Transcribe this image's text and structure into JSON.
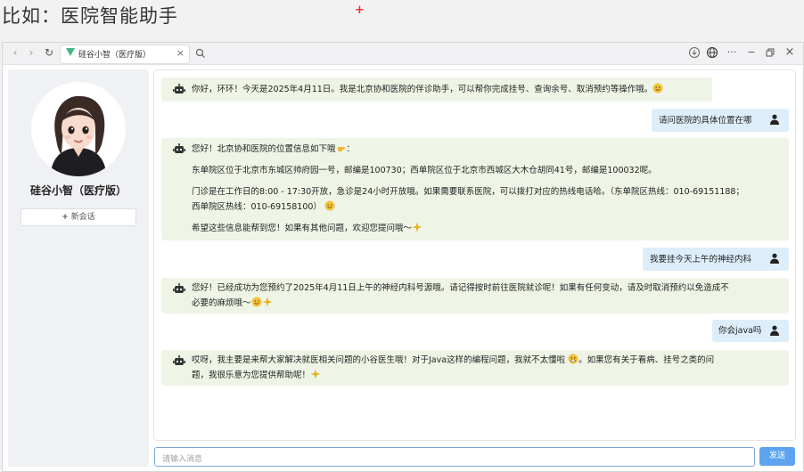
{
  "slide": {
    "title": "比如：医院智能助手"
  },
  "browser": {
    "tab_title": "硅谷小智（医疗版）",
    "tab_close": "×",
    "controls": [
      "download-icon",
      "globe-icon",
      "more-icon",
      "minimize-icon",
      "restore-icon",
      "close-icon"
    ],
    "control_glyphs": {
      "minimize": "−",
      "close": "×",
      "more": "···"
    }
  },
  "sidebar": {
    "assistant_name": "硅谷小智（医疗版）",
    "new_chat_label": "新会话",
    "new_chat_plus": "+"
  },
  "messages": [
    {
      "role": "bot",
      "lines": [
        "你好，环环！今天是2025年4月11日。我是北京协和医院的伴诊助手，可以帮你完成挂号、查询余号、取消预约等操作哦。"
      ],
      "trailing_emoji": "smile"
    },
    {
      "role": "user",
      "text": "请问医院的具体位置在哪"
    },
    {
      "role": "bot",
      "lines": [
        "您好！北京协和医院的位置信息如下哦",
        "东单院区位于北京市东城区帅府园一号，邮编是100730；西单院区位于北京市西城区大木仓胡同41号，邮编是100032呢。",
        "门诊是在工作日的8:00 - 17:30开放，急诊是24小时开放哦。如果需要联系医院，可以拨打对应的热线电话哈。（东单院区热线：010-69151188；",
        "西单院区热线：010-69158100）",
        "希望这些信息能帮到您！如果有其他问题，欢迎您提问哦～"
      ]
    },
    {
      "role": "user",
      "text": "我要挂今天上午的神经内科"
    },
    {
      "role": "bot",
      "lines": [
        "您好！已经成功为您预约了2025年4月11日上午的神经内科号源哦。请记得按时前往医院就诊呢！如果有任何变动，请及时取消预约以免造成不",
        "必要的麻烦哦～"
      ]
    },
    {
      "role": "user",
      "text": "你会java吗"
    },
    {
      "role": "bot",
      "lines": [
        "哎呀，我主要是来帮大家解决就医相关问题的小谷医生哦！对于Java这样的编程问题，我就不太懂啦",
        "。如果您有关于看病、挂号之类的问",
        "题，我很乐意为您提供帮助呢！"
      ]
    }
  ],
  "input": {
    "placeholder": "请输入消息",
    "value": ""
  },
  "send_label": "发送",
  "colors": {
    "bot_bubble": "#eef5e7",
    "user_bubble": "#ddeefa",
    "send_button": "#5da3ef",
    "sidebar_bg": "#f0f1f4",
    "accent_plus": "#e03030"
  }
}
